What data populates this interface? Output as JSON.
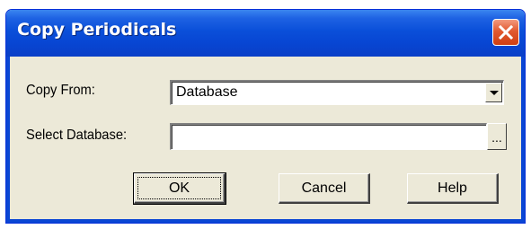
{
  "window": {
    "title": "Copy Periodicals",
    "close_icon": "close-icon"
  },
  "form": {
    "copy_from_label": "Copy From:",
    "copy_from_value": "Database",
    "select_database_label": "Select Database:",
    "select_database_value": "",
    "browse_label": "..."
  },
  "buttons": {
    "ok_label": "OK",
    "cancel_label": "Cancel",
    "help_label": "Help"
  },
  "colors": {
    "titlebar": "#0a4fd9",
    "dialog_background": "#ece9d8",
    "close_button": "#e2592f"
  }
}
